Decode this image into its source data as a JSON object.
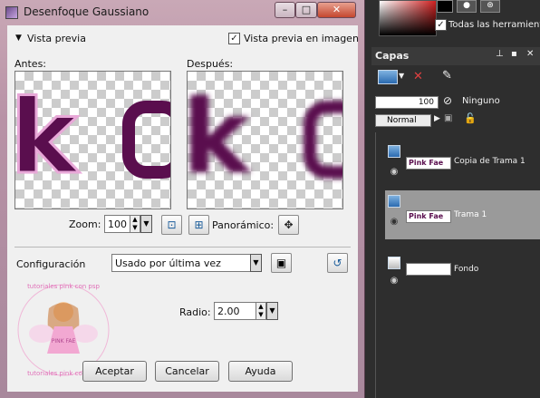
{
  "dialog": {
    "title": "Desenfoque Gaussiano",
    "controls": {
      "minimize": "–",
      "maximize": "□",
      "close": "✕"
    },
    "preview_toggle": "Vista previa",
    "preview_in_image": "Vista previa en imagen",
    "preview_in_image_checked": true,
    "before_label": "Antes:",
    "after_label": "Después:",
    "preview_text": "k",
    "zoom_label": "Zoom:",
    "zoom_value": "100",
    "pan_label": "Panorámico:",
    "config_label": "Configuración",
    "config_value": "Usado por última vez",
    "radius_label": "Radio:",
    "radius_value": "2.00",
    "buttons": {
      "accept": "Aceptar",
      "cancel": "Cancelar",
      "help": "Ayuda"
    },
    "watermark": {
      "top": "tutoriales pink con psp",
      "center": "PINK FAE",
      "bottom": "tutoriales pink con psp"
    }
  },
  "right_panel": {
    "all_tools": "Todas las herramientas",
    "all_tools_checked": true,
    "layers_title": "Capas",
    "opacity_value": "100",
    "blend_toggle_label": "Ninguno",
    "blend_mode": "Normal",
    "layers": [
      {
        "name": "Copia de Trama 1",
        "thumb_text": "Pink Fae",
        "selected": false
      },
      {
        "name": "Trama 1",
        "thumb_text": "Pink Fae",
        "selected": true
      },
      {
        "name": "Fondo",
        "thumb_text": "",
        "selected": false
      }
    ]
  },
  "colors": {
    "title_bar": "#c9a8b6",
    "close_button": "#c4472f",
    "text_purple": "#5a0e4e",
    "layer_selected": "#9a9a9a",
    "panel_bg": "#2e2e2e"
  }
}
